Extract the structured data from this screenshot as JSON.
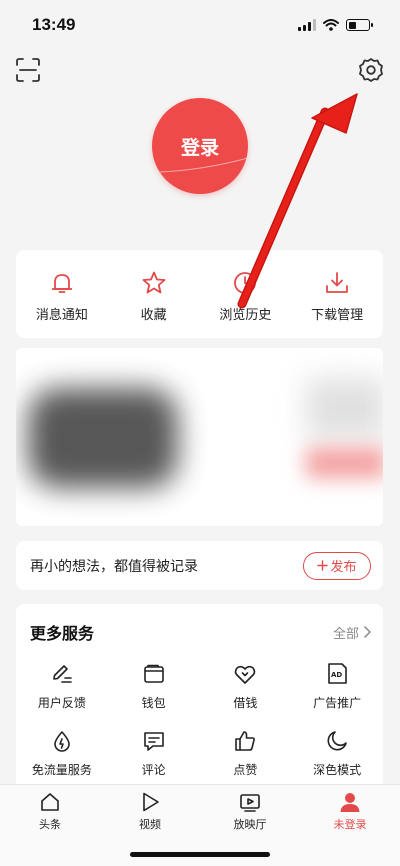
{
  "status_bar": {
    "time": "13:49"
  },
  "header": {
    "scan_icon": "scan-icon",
    "settings_icon": "gear-icon"
  },
  "login": {
    "label": "登录"
  },
  "quick_actions": [
    {
      "label": "消息通知",
      "icon": "bell-icon"
    },
    {
      "label": "收藏",
      "icon": "star-icon"
    },
    {
      "label": "浏览历史",
      "icon": "clock-icon"
    },
    {
      "label": "下载管理",
      "icon": "download-icon"
    }
  ],
  "post": {
    "prompt": "再小的想法，都值得被记录",
    "button_label": "发布"
  },
  "services": {
    "title": "更多服务",
    "all_label": "全部",
    "items": [
      {
        "label": "用户反馈",
        "icon": "feedback-pen-icon"
      },
      {
        "label": "钱包",
        "icon": "wallet-icon"
      },
      {
        "label": "借钱",
        "icon": "loan-icon"
      },
      {
        "label": "广告推广",
        "icon": "ad-icon"
      },
      {
        "label": "免流量服务",
        "icon": "data-drop-icon"
      },
      {
        "label": "评论",
        "icon": "comment-icon"
      },
      {
        "label": "点赞",
        "icon": "thumbs-up-icon"
      },
      {
        "label": "深色模式",
        "icon": "moon-icon"
      }
    ]
  },
  "tabbar": {
    "tabs": [
      {
        "label": "头条",
        "icon": "home-icon",
        "active": false
      },
      {
        "label": "视频",
        "icon": "play-icon",
        "active": false
      },
      {
        "label": "放映厅",
        "icon": "tv-icon",
        "active": false
      },
      {
        "label": "未登录",
        "icon": "user-icon",
        "active": true
      }
    ]
  },
  "colors": {
    "accent": "#e24a4a",
    "login_bg": "#ef4a4a",
    "annotation_arrow": "#e8201a"
  }
}
